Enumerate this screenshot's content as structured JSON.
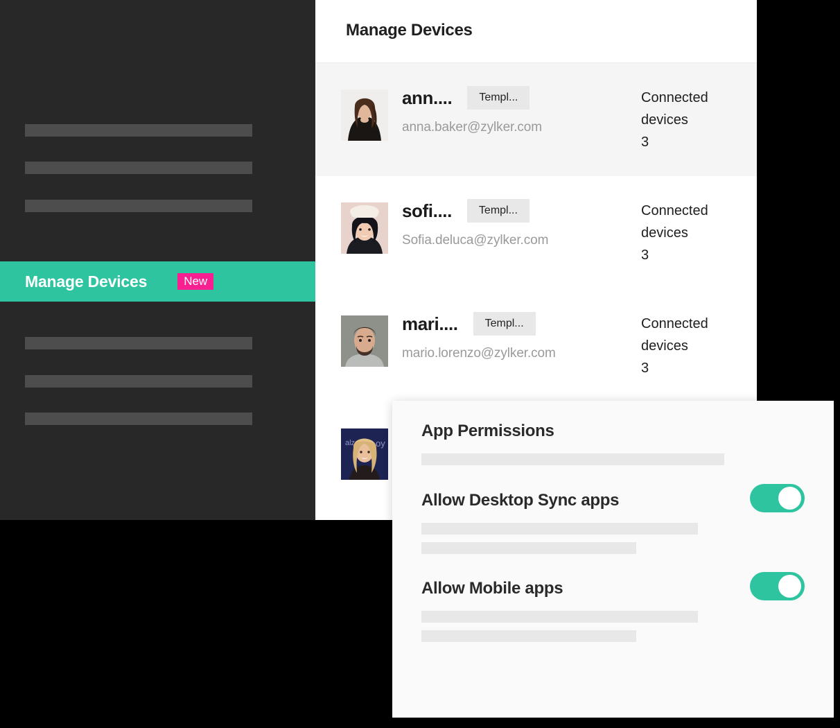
{
  "sidebar": {
    "active_item": {
      "label": "Manage Devices",
      "badge": "New"
    },
    "placeholder_bars": 6,
    "background_color": "#282828",
    "active_color": "#2ec4a0",
    "badge_color": "#f81f91"
  },
  "card": {
    "title": "Manage Devices",
    "devices_label_line1": "Connected",
    "devices_label_line2": "devices",
    "rows": [
      {
        "name": "ann....",
        "tag": "Templ...",
        "email": "anna.baker@zylker.com",
        "connected_devices": "3",
        "avatar": "avatar-anna"
      },
      {
        "name": "sofi....",
        "tag": "Templ...",
        "email": "Sofia.deluca@zylker.com",
        "connected_devices": "3",
        "avatar": "avatar-sofia"
      },
      {
        "name": "mari....",
        "tag": "Templ...",
        "email": "mario.lorenzo@zylker.com",
        "connected_devices": "3",
        "avatar": "avatar-mario"
      },
      {
        "name": "",
        "tag": "",
        "email": "",
        "connected_devices": "",
        "avatar": "avatar-fourth"
      }
    ]
  },
  "panel": {
    "title": "App Permissions",
    "permissions": [
      {
        "label": "Allow Desktop Sync apps",
        "state": "on"
      },
      {
        "label": "Allow Mobile apps",
        "state": "on"
      }
    ],
    "toggle_on_color": "#2ec4a0"
  }
}
